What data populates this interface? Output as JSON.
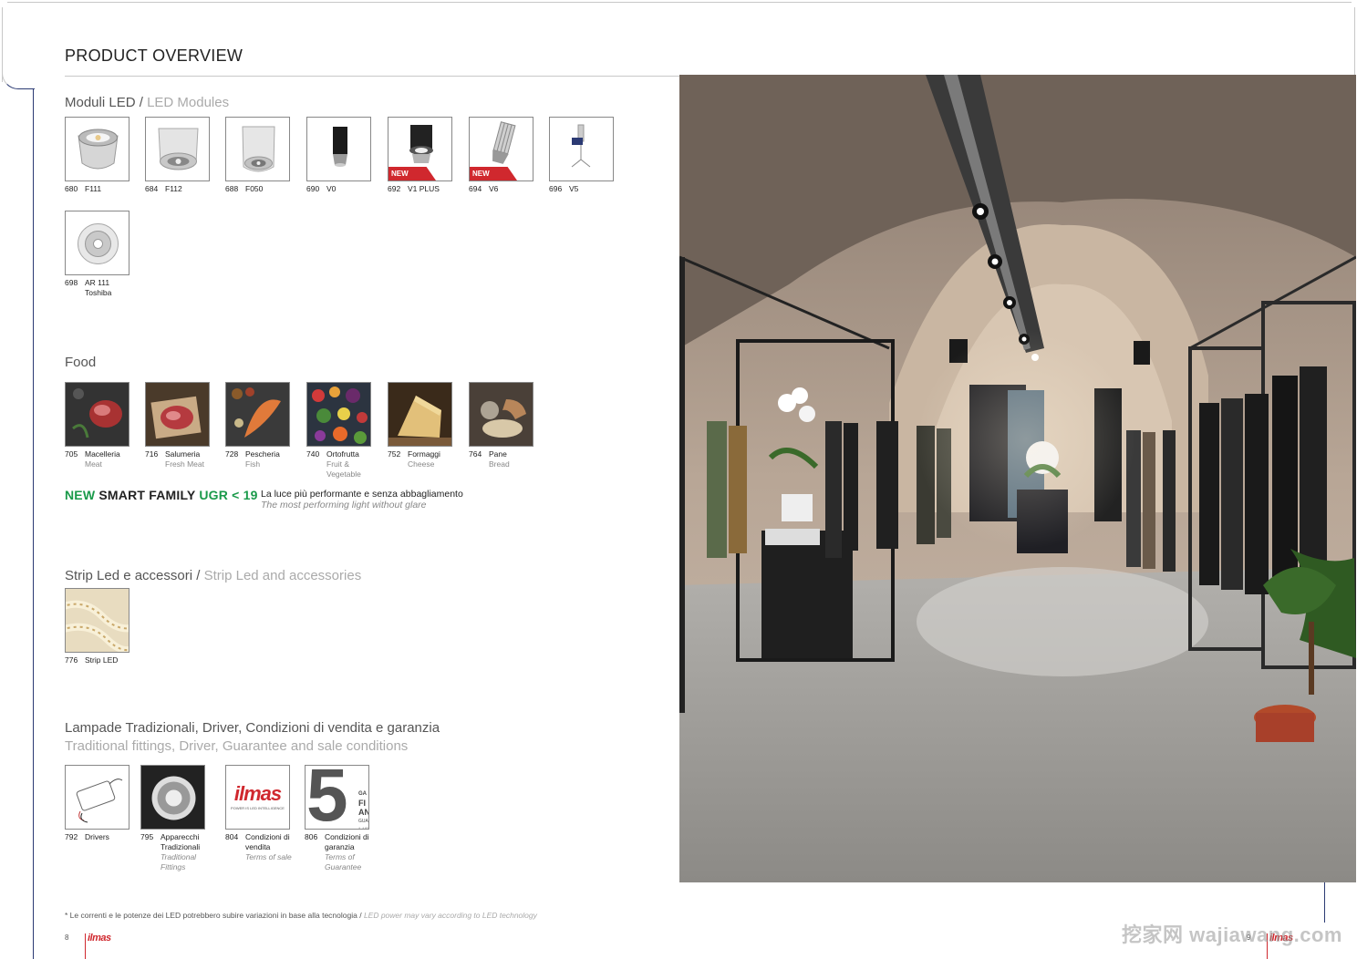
{
  "header": {
    "title": "PRODUCT OVERVIEW"
  },
  "sections": {
    "led": {
      "title_it": "Moduli LED",
      "sep": "/",
      "title_en": "LED  Modules"
    },
    "food": {
      "title": "Food"
    },
    "strip": {
      "title_it": "Strip Led e accessori",
      "sep": "/",
      "title_en": "Strip Led and accessories"
    },
    "lamps": {
      "title": "Lampade Tradizionali, Driver, Condizioni di vendita e garanzia",
      "subtitle": "Traditional fittings, Driver, Guarantee and sale conditions"
    }
  },
  "led_items": [
    {
      "num": "680",
      "label": "F111",
      "sub": "",
      "new": ""
    },
    {
      "num": "684",
      "label": "F112",
      "sub": "",
      "new": ""
    },
    {
      "num": "688",
      "label": "F050",
      "sub": "",
      "new": ""
    },
    {
      "num": "690",
      "label": "V0",
      "sub": "",
      "new": ""
    },
    {
      "num": "692",
      "label": "V1 PLUS",
      "sub": "",
      "new": "NEW"
    },
    {
      "num": "694",
      "label": "V6",
      "sub": "",
      "new": "NEW"
    },
    {
      "num": "696",
      "label": "V5",
      "sub": "",
      "new": ""
    },
    {
      "num": "698",
      "label": "AR 111",
      "sub": "Toshiba",
      "new": ""
    }
  ],
  "food_items": [
    {
      "num": "705",
      "label": "Macelleria",
      "sub": "Meat"
    },
    {
      "num": "716",
      "label": "Salumeria",
      "sub": "Fresh Meat"
    },
    {
      "num": "728",
      "label": "Pescheria",
      "sub": "Fish"
    },
    {
      "num": "740",
      "label": "Ortofrutta",
      "sub": "Fruit &",
      "sub2": "Vegetable"
    },
    {
      "num": "752",
      "label": "Formaggi",
      "sub": "Cheese"
    },
    {
      "num": "764",
      "label": "Pane",
      "sub": "Bread"
    }
  ],
  "smart": {
    "new": "NEW",
    "name": "SMART FAMILY",
    "ugr": "UGR < 19",
    "desc_it": "La luce più performante e senza abbagliamento",
    "desc_en": "The most performing light without glare"
  },
  "strip_items": [
    {
      "num": "776",
      "label": "Strip LED"
    }
  ],
  "lamp_items": [
    {
      "num": "792",
      "label": "Drivers",
      "label2": "",
      "sub": "",
      "sub2": ""
    },
    {
      "num": "795",
      "label": "Apparecchi",
      "label2": "Tradizionali",
      "sub": "Traditional",
      "sub2": "Fittings"
    },
    {
      "num": "804",
      "label": "Condizioni di",
      "label2": "vendita",
      "sub": "Terms of sale",
      "sub2": ""
    },
    {
      "num": "806",
      "label": "Condizioni di",
      "label2": "garanzia",
      "sub": "Terms of",
      "sub2": "Guarantee"
    }
  ],
  "brand_tile": {
    "logo": "ilmas",
    "tagline": "POWER IS LED INTELLIGENCE"
  },
  "guarantee_tile": {
    "digit": "5",
    "t1": "GA",
    "t2": "FI",
    "t3": "AN",
    "t4": "GUA",
    "t5": "UF"
  },
  "footnote": {
    "it": "* Le correnti e le potenze dei LED potrebbero subire variazioni in base alla tecnologia",
    "sep": " / ",
    "en": "LED power may vary according to LED technology"
  },
  "footer": {
    "page_left": "8",
    "page_right": "9",
    "logo": "ilmas"
  },
  "watermark": "挖家网 wajiawang.com",
  "colors": {
    "accent_red": "#d0282e",
    "accent_green": "#1a9a4a",
    "frame_blue": "#2b3a73"
  }
}
